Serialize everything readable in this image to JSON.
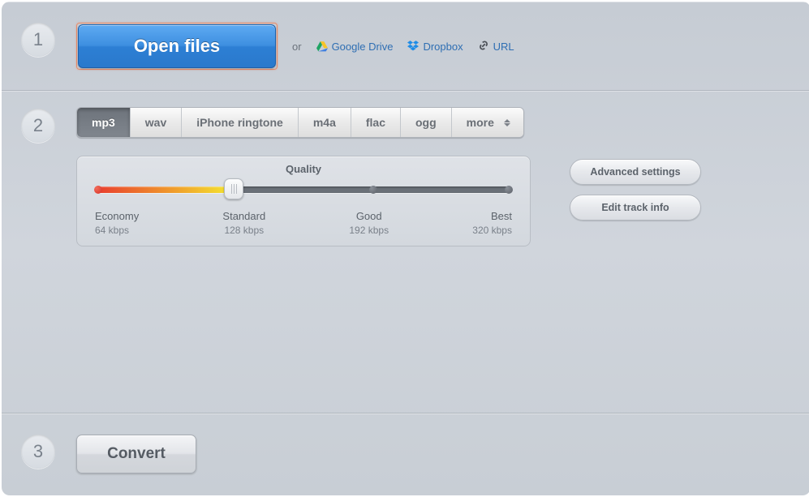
{
  "step1": {
    "number": "1",
    "open_label": "Open files",
    "or_text": "or",
    "sources": {
      "gdrive": "Google Drive",
      "dropbox": "Dropbox",
      "url": "URL"
    }
  },
  "step2": {
    "number": "2",
    "tabs": [
      "mp3",
      "wav",
      "iPhone ringtone",
      "m4a",
      "flac",
      "ogg",
      "more"
    ],
    "selected_tab_index": 0,
    "quality": {
      "title": "Quality",
      "stops": [
        {
          "name": "Economy",
          "bitrate": "64 kbps"
        },
        {
          "name": "Standard",
          "bitrate": "128 kbps"
        },
        {
          "name": "Good",
          "bitrate": "192 kbps"
        },
        {
          "name": "Best",
          "bitrate": "320 kbps"
        }
      ],
      "selected_index": 1
    },
    "advanced_label": "Advanced settings",
    "edit_track_label": "Edit track info"
  },
  "step3": {
    "number": "3",
    "convert_label": "Convert"
  }
}
